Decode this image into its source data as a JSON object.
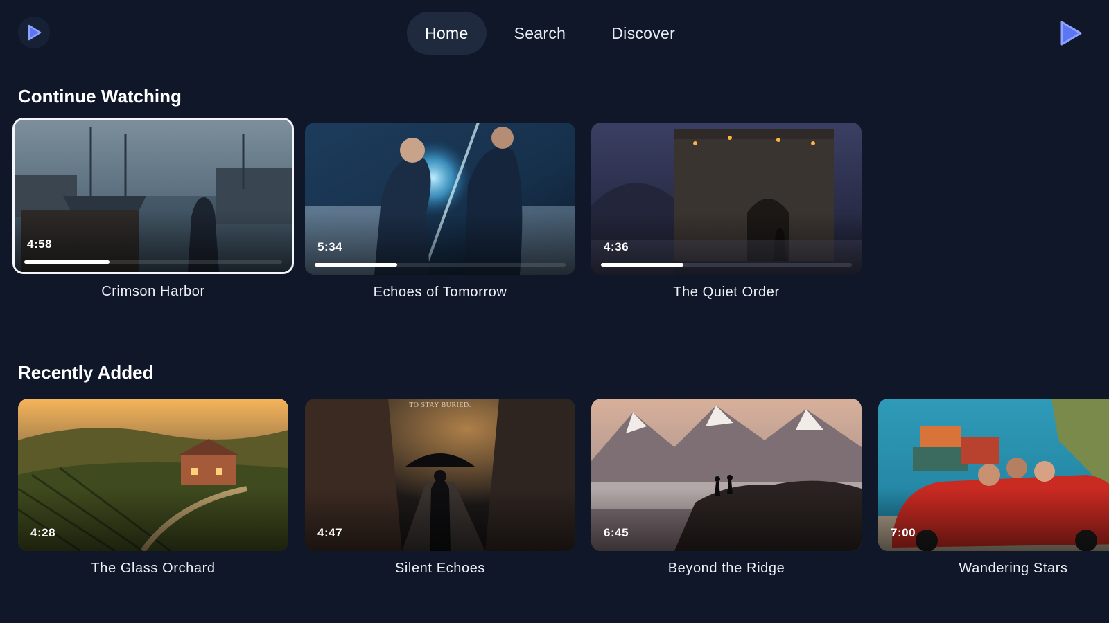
{
  "nav": {
    "tabs": [
      {
        "label": "Home",
        "active": true
      },
      {
        "label": "Search",
        "active": false
      },
      {
        "label": "Discover",
        "active": false
      }
    ]
  },
  "icons": {
    "left_logo": "play-logo-icon",
    "right_logo": "play-logo-icon"
  },
  "colors": {
    "background": "#0f1729",
    "active_tab": "#1f2a3f",
    "logo_accent": "#5b76f0"
  },
  "continue_watching": {
    "title": "Continue Watching",
    "items": [
      {
        "title": "Crimson Harbor",
        "duration": "4:58",
        "progress": 0.33,
        "focused": true
      },
      {
        "title": "Echoes of Tomorrow",
        "duration": "5:34",
        "progress": 0.33,
        "focused": false
      },
      {
        "title": "The Quiet Order",
        "duration": "4:36",
        "progress": 0.33,
        "focused": false
      }
    ]
  },
  "recently_added": {
    "title": "Recently Added",
    "items": [
      {
        "title": "The Glass Orchard",
        "duration": "4:28"
      },
      {
        "title": "Silent Echoes",
        "duration": "4:47",
        "poster_text": "TO STAY BURIED."
      },
      {
        "title": "Beyond the Ridge",
        "duration": "6:45"
      },
      {
        "title": "Wandering Stars",
        "duration": "7:00"
      }
    ]
  }
}
